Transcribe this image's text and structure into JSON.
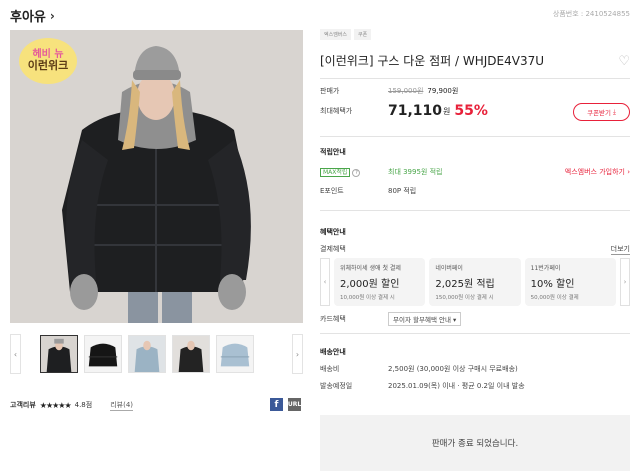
{
  "header": {
    "brand": "후아유",
    "product_no": "상품번호 : 2410524855"
  },
  "badge": {
    "line1": "헤비 뉴",
    "line2": "이런위크"
  },
  "thumbnails": {
    "prev": "‹",
    "next": "›"
  },
  "review": {
    "label": "고객리뷰",
    "stars": "★★★★★",
    "score": "4.8점",
    "link": "리뷰(4)",
    "fb": "f",
    "url": "URL"
  },
  "product": {
    "tags": [
      "엑스엠버스",
      "쿠폰"
    ],
    "title": "[이런위크] 구스 다운 점퍼 / WHJDE4V37U",
    "price_label": "판매가",
    "orig_price": "159,000원",
    "sale_price": "79,900원",
    "best_label": "최대혜택가",
    "best_price": "71,110",
    "won": "원",
    "discount": "55%",
    "coupon_btn": "쿠폰받기"
  },
  "points": {
    "title": "적립안내",
    "max_tag": "MAX적립",
    "max_text": "최대 3995원 적립",
    "member_link": "엑스엠버스 가입하기 ›",
    "epoint_label": "E포인트",
    "epoint_value": "80P 적립"
  },
  "benefit": {
    "title": "혜택안내",
    "pay_label": "결제혜택",
    "more": "더보기",
    "cards": [
      {
        "top": "위체하이세 생애 첫 결제",
        "main": "2,000원 할인",
        "sub": "10,000원 이상 결제 시"
      },
      {
        "top": "네이버페이",
        "main": "2,025원 적립",
        "sub": "150,000원 이상 결제 시"
      },
      {
        "top": "11번가페이",
        "main": "10% 할인",
        "sub": "50,000원 이상 결제"
      }
    ],
    "card_label": "카드혜택",
    "card_select": "무이자 할부혜택 안내 ▾"
  },
  "delivery": {
    "title": "배송안내",
    "fee_label": "배송비",
    "fee_value": "2,500원 (30,000원 이상 구매시 무료배송)",
    "date_label": "발송예정일",
    "date_value": "2025.01.09(목) 이내 · 평균 0.2일 이내 발송"
  },
  "soldout": "판매가 종료 되었습니다.",
  "colors": {
    "accent": "#e8213a",
    "green": "#4aa64a",
    "fb": "#3b5998"
  }
}
